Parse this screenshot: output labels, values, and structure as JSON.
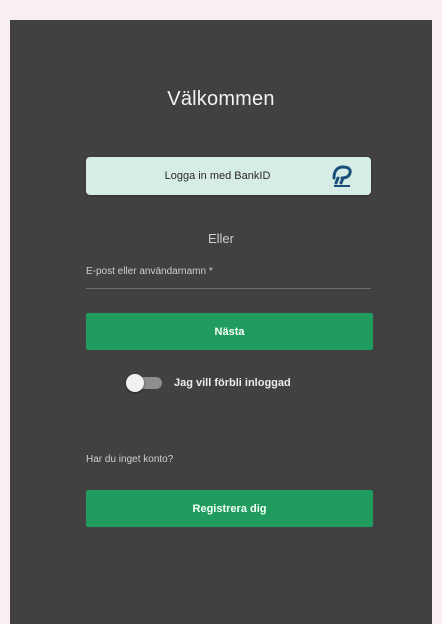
{
  "login": {
    "title": "Välkommen",
    "bankid_button_label": "Logga in med BankID",
    "bankid_icon": "bankid-logo",
    "separator_text": "Eller",
    "email_label": "E-post eller användarnamn *",
    "email_value": "",
    "next_button_label": "Nästa",
    "remember_label": "Jag vill förbli inloggad",
    "remember_checked": false,
    "no_account_text": "Har du inget konto?",
    "register_button_label": "Registrera dig"
  },
  "colors": {
    "page_background": "#f9eef0",
    "panel_background": "#414141",
    "primary_green": "#1f9c5e",
    "bankid_button_background": "#d6ede6",
    "bankid_brand": "#1a4f7a"
  }
}
